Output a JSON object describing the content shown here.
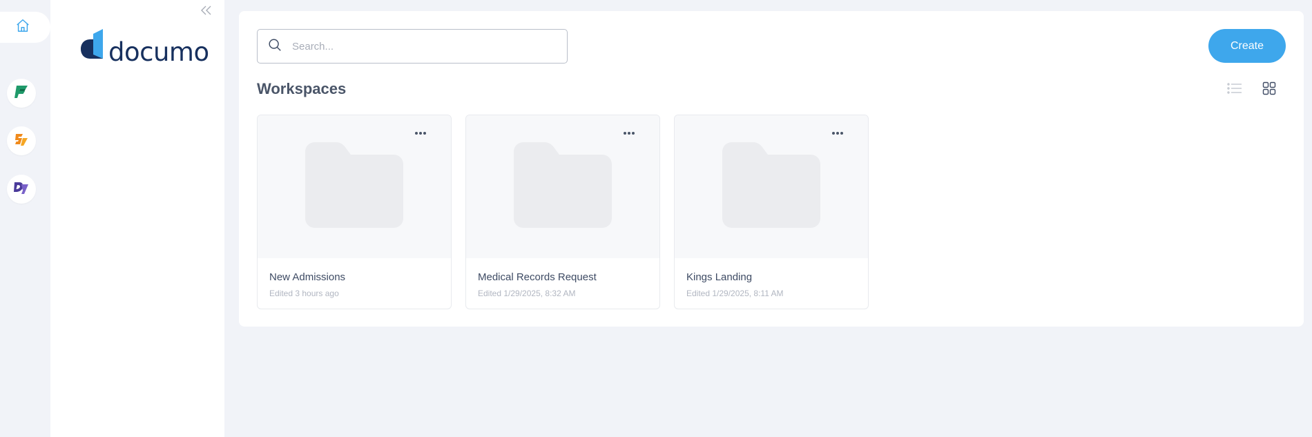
{
  "brand": {
    "name": "documo"
  },
  "rail": {
    "apps": [
      {
        "icon": "home-icon",
        "color": "#3ea7ec"
      },
      {
        "icon": "green-app-icon",
        "color": "#1f9a6a"
      },
      {
        "icon": "orange-app-icon",
        "color": "#f08a1c"
      },
      {
        "icon": "purple-app-icon",
        "color": "#6a4fb5"
      }
    ]
  },
  "search": {
    "placeholder": "Search..."
  },
  "toolbar": {
    "create_label": "Create"
  },
  "page": {
    "title": "Workspaces"
  },
  "workspaces": [
    {
      "name": "New Admissions",
      "edited": "Edited 3 hours ago"
    },
    {
      "name": "Medical Records Request",
      "edited": "Edited 1/29/2025, 8:32 AM"
    },
    {
      "name": "Kings Landing",
      "edited": "Edited 1/29/2025, 8:11 AM"
    }
  ],
  "colors": {
    "accent": "#3ea7ec",
    "brand_dark": "#17305e",
    "brand_blue": "#3ea7ec"
  }
}
